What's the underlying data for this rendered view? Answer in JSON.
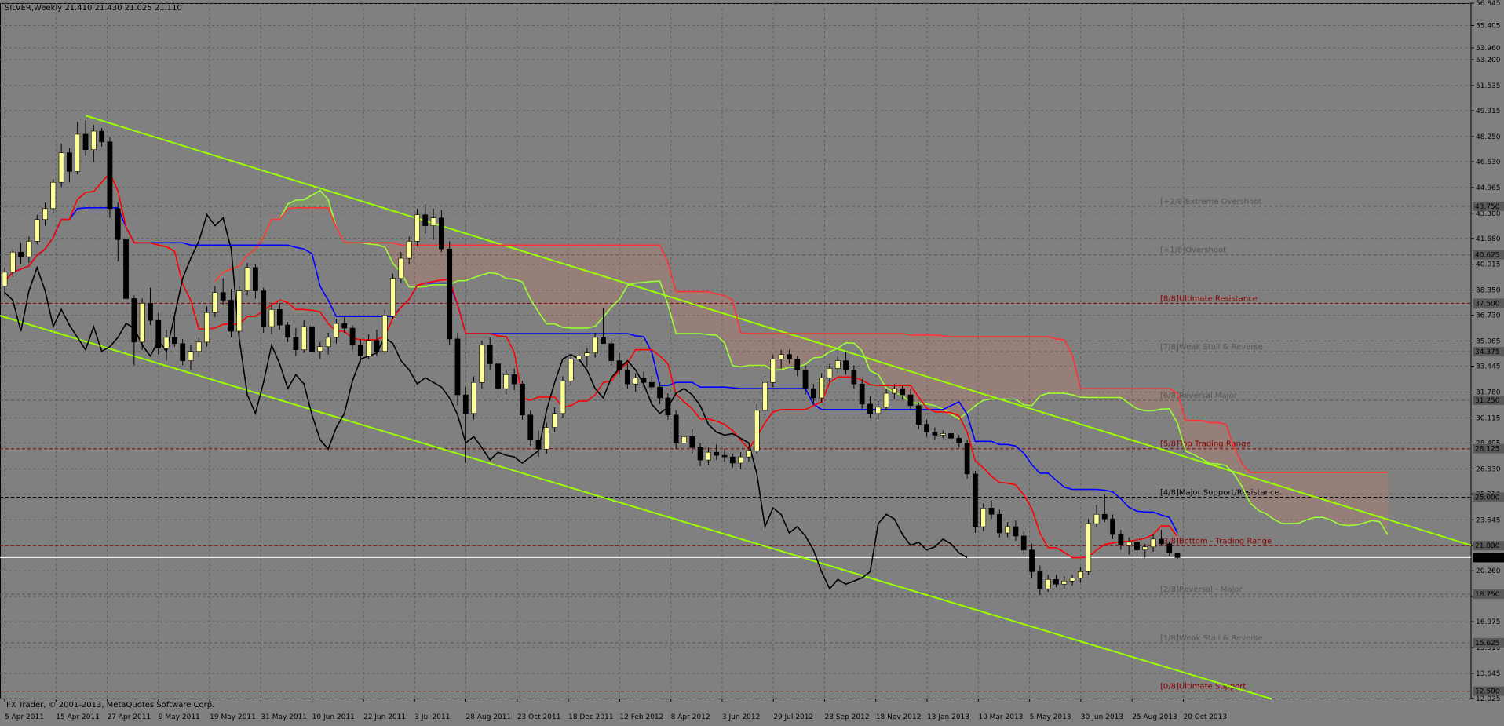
{
  "header": {
    "symbol_text": "SILVER,Weekly  21.410 21.430 21.025 21.110"
  },
  "copyright": "FX Trader, © 2001-2013, MetaQuotes Software Corp.",
  "colors": {
    "background": "#808080",
    "grid": "#5e5e5e",
    "bull_candle": "#ffff99",
    "bear_candle": "#000000",
    "tenkan": "#ff0000",
    "kijun": "#0000ff",
    "chikou": "#000000",
    "span_a": "#99ff33",
    "span_b": "#ff3333",
    "channel": "#99ff00"
  },
  "chart_data": {
    "type": "candlestick",
    "title": "SILVER,Weekly",
    "ohlc_last": {
      "open": 21.41,
      "high": 21.43,
      "low": 21.025,
      "close": 21.11
    },
    "ylim": [
      12.025,
      56.845
    ],
    "y_ticks": [
      "56.845",
      "55.405",
      "53.960",
      "53.200",
      "51.535",
      "49.915",
      "48.250",
      "46.630",
      "44.965",
      "43.300",
      "41.680",
      "40.015",
      "38.350",
      "36.730",
      "35.065",
      "33.445",
      "31.780",
      "30.115",
      "28.495",
      "26.830",
      "25.210",
      "23.545",
      "21.880",
      "20.260",
      "18.595",
      "16.975",
      "15.310",
      "13.645",
      "12.025"
    ],
    "x_tick_labels": [
      "5 Apr 2011",
      "15 Apr 2011",
      "27 Apr 2011",
      "9 May 2011",
      "19 May 2011",
      "31 May 2011",
      "10 Jun 2011",
      "22 Jun 2011",
      "3 Jul 2011",
      "28 Aug 2011",
      "23 Oct 2011",
      "18 Dec 2011",
      "12 Feb 2012",
      "8 Apr 2012",
      "3 Jun 2012",
      "29 Jul 2012",
      "23 Sep 2012",
      "18 Nov 2012",
      "13 Jan 2013",
      "10 Mar 2013",
      "5 May 2013",
      "30 Jun 2013",
      "25 Aug 2013",
      "20 Oct 2013"
    ],
    "price_badges": [
      {
        "value": "43.750",
        "kind": "level"
      },
      {
        "value": "40.625",
        "kind": "level"
      },
      {
        "value": "37.500",
        "kind": "level"
      },
      {
        "value": "34.375",
        "kind": "level"
      },
      {
        "value": "31.250",
        "kind": "level"
      },
      {
        "value": "28.125",
        "kind": "level"
      },
      {
        "value": "25.000",
        "kind": "level"
      },
      {
        "value": "21.880",
        "kind": "level"
      },
      {
        "value": "21.110",
        "kind": "current"
      },
      {
        "value": "18.750",
        "kind": "level"
      },
      {
        "value": "15.625",
        "kind": "level"
      },
      {
        "value": "12.500",
        "kind": "level"
      }
    ],
    "murrey_levels": [
      {
        "label": "[+2/8]Extreme Overshoot",
        "value": 43.75,
        "color": "#555555"
      },
      {
        "label": "[+1/8]Overshoot",
        "value": 40.625,
        "color": "#555555"
      },
      {
        "label": "[8/8]Ultimate Resistance",
        "value": 37.5,
        "color": "#8b0000"
      },
      {
        "label": "[7/8]Weak Stall & Reverse",
        "value": 34.375,
        "color": "#555555"
      },
      {
        "label": "[6/8]Reversal Major",
        "value": 31.25,
        "color": "#555555"
      },
      {
        "label": "[5/8]Top Trading Range",
        "value": 28.125,
        "color": "#8b0000"
      },
      {
        "label": "[4/8]Major Support/Resistance",
        "value": 25.0,
        "color": "#000000"
      },
      {
        "label": "[3/8]Bottom - Trading Range",
        "value": 21.875,
        "color": "#8b0000"
      },
      {
        "label": "[2/8]Reversal - Major",
        "value": 18.75,
        "color": "#555555"
      },
      {
        "label": "[1/8]Weak Stall & Reverse",
        "value": 15.625,
        "color": "#555555"
      },
      {
        "label": "[0/8]Ultimate Support",
        "value": 12.5,
        "color": "#8b0000"
      }
    ],
    "candles": [
      [
        38.6,
        39.8,
        38.0,
        39.5
      ],
      [
        39.5,
        41.0,
        39.2,
        40.8
      ],
      [
        40.8,
        41.4,
        40.0,
        40.5
      ],
      [
        40.5,
        41.8,
        40.1,
        41.5
      ],
      [
        41.5,
        43.2,
        41.3,
        42.9
      ],
      [
        42.9,
        44.0,
        42.5,
        43.6
      ],
      [
        43.6,
        45.5,
        43.3,
        45.3
      ],
      [
        45.3,
        47.8,
        45.0,
        47.2
      ],
      [
        47.2,
        47.5,
        45.3,
        46.0
      ],
      [
        46.0,
        49.2,
        45.8,
        48.4
      ],
      [
        48.4,
        49.3,
        47.0,
        47.4
      ],
      [
        47.4,
        49.0,
        46.6,
        48.6
      ],
      [
        48.6,
        48.8,
        47.6,
        47.9
      ],
      [
        47.9,
        48.2,
        43.0,
        43.6
      ],
      [
        43.6,
        44.0,
        40.2,
        41.6
      ],
      [
        41.6,
        42.2,
        35.5,
        37.8
      ],
      [
        37.8,
        38.0,
        33.5,
        35.0
      ],
      [
        35.0,
        37.8,
        34.5,
        37.5
      ],
      [
        37.5,
        38.5,
        36.1,
        36.4
      ],
      [
        36.4,
        36.9,
        34.2,
        34.6
      ],
      [
        34.6,
        35.8,
        33.8,
        35.3
      ],
      [
        35.3,
        36.6,
        34.7,
        34.9
      ],
      [
        34.9,
        35.2,
        33.5,
        33.8
      ],
      [
        33.8,
        34.8,
        33.2,
        34.4
      ],
      [
        34.4,
        35.3,
        34.0,
        35.0
      ],
      [
        35.0,
        37.3,
        34.7,
        36.9
      ],
      [
        36.9,
        38.6,
        36.6,
        38.2
      ],
      [
        38.2,
        39.1,
        37.4,
        37.7
      ],
      [
        37.7,
        38.4,
        35.3,
        35.7
      ],
      [
        35.7,
        38.6,
        35.4,
        38.3
      ],
      [
        38.3,
        40.1,
        38.0,
        39.8
      ],
      [
        39.8,
        40.0,
        37.8,
        38.3
      ],
      [
        38.3,
        38.5,
        35.6,
        36.0
      ],
      [
        36.0,
        37.4,
        35.5,
        37.1
      ],
      [
        37.1,
        37.5,
        35.8,
        36.1
      ],
      [
        36.1,
        36.3,
        35.0,
        35.3
      ],
      [
        35.3,
        35.9,
        34.1,
        34.5
      ],
      [
        34.5,
        36.4,
        34.3,
        36.0
      ],
      [
        36.0,
        36.3,
        34.0,
        34.4
      ],
      [
        34.4,
        35.0,
        33.9,
        34.7
      ],
      [
        34.7,
        35.6,
        34.2,
        35.3
      ],
      [
        35.3,
        36.5,
        34.9,
        36.2
      ],
      [
        36.2,
        36.6,
        35.6,
        35.9
      ],
      [
        35.9,
        36.1,
        34.5,
        34.8
      ],
      [
        34.8,
        35.2,
        33.7,
        34.1
      ],
      [
        34.1,
        35.5,
        33.9,
        35.1
      ],
      [
        35.1,
        35.8,
        34.1,
        34.4
      ],
      [
        34.4,
        37.1,
        34.2,
        36.7
      ],
      [
        36.7,
        39.4,
        36.5,
        39.1
      ],
      [
        39.1,
        40.8,
        38.8,
        40.4
      ],
      [
        40.4,
        41.8,
        40.0,
        41.5
      ],
      [
        41.5,
        43.6,
        41.2,
        43.2
      ],
      [
        43.2,
        43.9,
        42.0,
        42.5
      ],
      [
        42.5,
        43.6,
        41.6,
        43.0
      ],
      [
        43.0,
        43.5,
        40.8,
        41.0
      ],
      [
        41.0,
        41.5,
        34.8,
        35.2
      ],
      [
        35.2,
        35.6,
        30.9,
        31.6
      ],
      [
        31.6,
        32.1,
        27.2,
        30.4
      ],
      [
        30.4,
        32.8,
        30.0,
        32.4
      ],
      [
        32.4,
        35.1,
        32.0,
        34.8
      ],
      [
        34.8,
        35.3,
        33.2,
        33.6
      ],
      [
        33.6,
        34.0,
        31.4,
        32.0
      ],
      [
        32.0,
        33.2,
        31.6,
        32.9
      ],
      [
        32.9,
        33.3,
        31.9,
        32.3
      ],
      [
        32.3,
        32.5,
        30.0,
        30.3
      ],
      [
        30.3,
        30.6,
        28.3,
        28.7
      ],
      [
        28.7,
        29.3,
        27.6,
        28.1
      ],
      [
        28.1,
        29.8,
        27.8,
        29.5
      ],
      [
        29.5,
        30.8,
        29.2,
        30.4
      ],
      [
        30.4,
        32.8,
        30.1,
        32.5
      ],
      [
        32.5,
        34.2,
        32.2,
        33.9
      ],
      [
        33.9,
        34.8,
        33.5,
        34.1
      ],
      [
        34.1,
        34.6,
        33.4,
        34.3
      ],
      [
        34.3,
        35.6,
        34.0,
        35.3
      ],
      [
        35.3,
        37.2,
        35.0,
        34.9
      ],
      [
        34.9,
        35.2,
        33.5,
        33.8
      ],
      [
        33.8,
        34.3,
        32.9,
        33.2
      ],
      [
        33.2,
        33.6,
        32.0,
        32.3
      ],
      [
        32.3,
        33.0,
        31.8,
        32.7
      ],
      [
        32.7,
        33.1,
        32.1,
        32.4
      ],
      [
        32.4,
        32.8,
        31.9,
        32.1
      ],
      [
        32.1,
        32.4,
        31.0,
        31.4
      ],
      [
        31.4,
        31.7,
        30.0,
        30.3
      ],
      [
        30.3,
        30.6,
        28.1,
        28.5
      ],
      [
        28.5,
        29.3,
        28.0,
        28.9
      ],
      [
        28.9,
        29.4,
        27.8,
        28.2
      ],
      [
        28.2,
        28.5,
        27.0,
        27.4
      ],
      [
        27.4,
        28.2,
        27.1,
        27.9
      ],
      [
        27.9,
        28.4,
        27.4,
        27.7
      ],
      [
        27.7,
        28.1,
        27.3,
        27.6
      ],
      [
        27.6,
        27.8,
        26.9,
        27.2
      ],
      [
        27.2,
        27.9,
        26.8,
        27.6
      ],
      [
        27.6,
        28.3,
        27.3,
        28.0
      ],
      [
        28.0,
        31.0,
        27.8,
        30.6
      ],
      [
        30.6,
        32.8,
        30.3,
        32.4
      ],
      [
        32.4,
        34.2,
        32.1,
        33.9
      ],
      [
        33.9,
        34.5,
        33.3,
        34.2
      ],
      [
        34.2,
        34.5,
        33.6,
        33.9
      ],
      [
        33.9,
        34.1,
        32.8,
        33.2
      ],
      [
        33.2,
        33.5,
        31.6,
        32.0
      ],
      [
        32.0,
        32.3,
        31.0,
        31.4
      ],
      [
        31.4,
        33.0,
        31.1,
        32.7
      ],
      [
        32.7,
        33.6,
        32.4,
        33.3
      ],
      [
        33.3,
        34.1,
        33.0,
        33.8
      ],
      [
        33.8,
        34.4,
        32.9,
        33.2
      ],
      [
        33.2,
        33.5,
        32.0,
        32.3
      ],
      [
        32.3,
        32.6,
        30.7,
        31.0
      ],
      [
        31.0,
        31.5,
        30.1,
        30.4
      ],
      [
        30.4,
        31.2,
        30.0,
        30.8
      ],
      [
        30.8,
        32.0,
        30.6,
        31.7
      ],
      [
        31.7,
        32.3,
        31.3,
        32.0
      ],
      [
        32.0,
        32.2,
        31.3,
        31.6
      ],
      [
        31.6,
        32.0,
        30.6,
        30.9
      ],
      [
        30.9,
        31.1,
        29.4,
        29.7
      ],
      [
        29.7,
        30.0,
        28.9,
        29.2
      ],
      [
        29.2,
        29.5,
        28.7,
        29.0
      ],
      [
        29.0,
        29.3,
        28.8,
        29.1
      ],
      [
        29.1,
        29.4,
        28.6,
        28.8
      ],
      [
        28.8,
        29.0,
        28.2,
        28.5
      ],
      [
        28.5,
        28.7,
        26.2,
        26.5
      ],
      [
        26.5,
        26.7,
        22.7,
        23.1
      ],
      [
        23.1,
        24.6,
        22.8,
        24.3
      ],
      [
        24.3,
        24.8,
        23.6,
        23.9
      ],
      [
        23.9,
        24.2,
        22.4,
        22.7
      ],
      [
        22.7,
        23.4,
        22.4,
        23.1
      ],
      [
        23.1,
        23.5,
        22.2,
        22.5
      ],
      [
        22.5,
        22.8,
        21.3,
        21.6
      ],
      [
        21.6,
        22.0,
        19.8,
        20.2
      ],
      [
        20.2,
        20.6,
        18.7,
        19.1
      ],
      [
        19.1,
        20.0,
        18.9,
        19.7
      ],
      [
        19.7,
        20.0,
        19.2,
        19.4
      ],
      [
        19.4,
        19.9,
        19.1,
        19.6
      ],
      [
        19.6,
        20.0,
        19.3,
        19.8
      ],
      [
        19.8,
        20.5,
        19.5,
        20.2
      ],
      [
        20.2,
        23.6,
        20.0,
        23.3
      ],
      [
        23.3,
        24.5,
        23.1,
        23.9
      ],
      [
        23.9,
        25.2,
        23.4,
        23.6
      ],
      [
        23.6,
        23.9,
        22.3,
        22.6
      ],
      [
        22.6,
        22.9,
        21.6,
        21.9
      ],
      [
        21.9,
        22.4,
        21.3,
        22.1
      ],
      [
        22.1,
        22.4,
        21.2,
        21.6
      ],
      [
        21.6,
        22.0,
        21.1,
        21.8
      ],
      [
        21.8,
        22.6,
        21.5,
        22.3
      ],
      [
        22.3,
        22.9,
        21.9,
        22.0
      ],
      [
        22.0,
        22.1,
        21.2,
        21.41
      ],
      [
        21.41,
        21.43,
        21.025,
        21.11
      ]
    ],
    "x_major_labels_positions_are_dates": true,
    "notes_visible": []
  }
}
